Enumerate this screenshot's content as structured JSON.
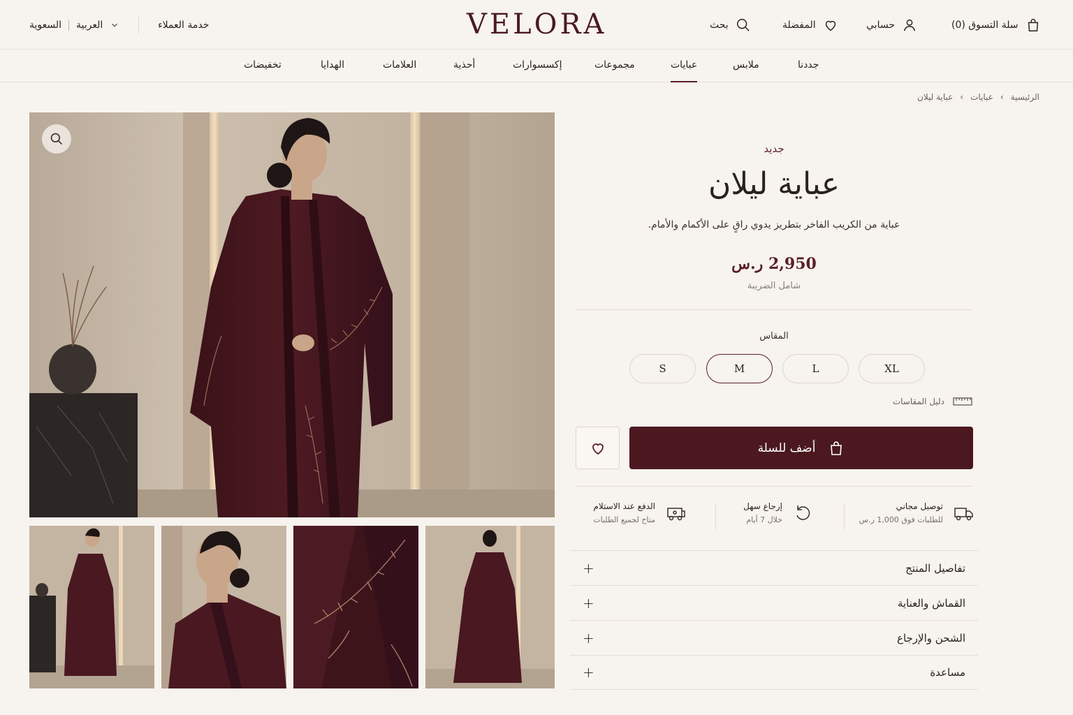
{
  "header": {
    "logo": "VELORA",
    "cart": "سلة التسوق (0)",
    "account": "حسابي",
    "favorites": "المفضلة",
    "search": "بحث",
    "customer_service": "خدمة العملاء",
    "language": "العربية",
    "country": "السعوية"
  },
  "nav": {
    "items": [
      "جددنا",
      "ملابس",
      "عبايات",
      "مجموعات",
      "إكسسوارات",
      "أحذية",
      "العلامات",
      "الهدايا",
      "تخفيضات"
    ],
    "active": "عبايات"
  },
  "breadcrumb": [
    "الرئيسية",
    "عبايات",
    "عباية ليلان"
  ],
  "product": {
    "badge": "جديد",
    "title": "عباية ليلان",
    "description": "عباية من الكريب الفاخر بتطريز يدوي راقٍ على الأكمام والأمام.",
    "price": "2,950 ر.س",
    "tax_note": "شامل الضريبة",
    "size_label": "المقاس",
    "sizes": [
      "XL",
      "L",
      "M",
      "S"
    ],
    "selected_size": "M",
    "size_guide": "دليل المقاسات",
    "add_to_cart": "أضف للسلة"
  },
  "features": [
    {
      "title": "توصيل مجاني",
      "subtitle": "للطلبات فوق 1,000 ر.س",
      "icon": "truck-icon"
    },
    {
      "title": "إرجاع سهل",
      "subtitle": "خلال 7 أيام",
      "icon": "return-icon"
    },
    {
      "title": "الدفع عند الاستلام",
      "subtitle": "متاح لجميع الطلبات",
      "icon": "cash-delivery-icon"
    }
  ],
  "accordion": [
    "تفاصيل المنتج",
    "القماش والعناية",
    "الشحن والإرجاع",
    "مساعدة"
  ],
  "colors": {
    "brand": "#4b1820",
    "background": "#f7f3ee"
  }
}
